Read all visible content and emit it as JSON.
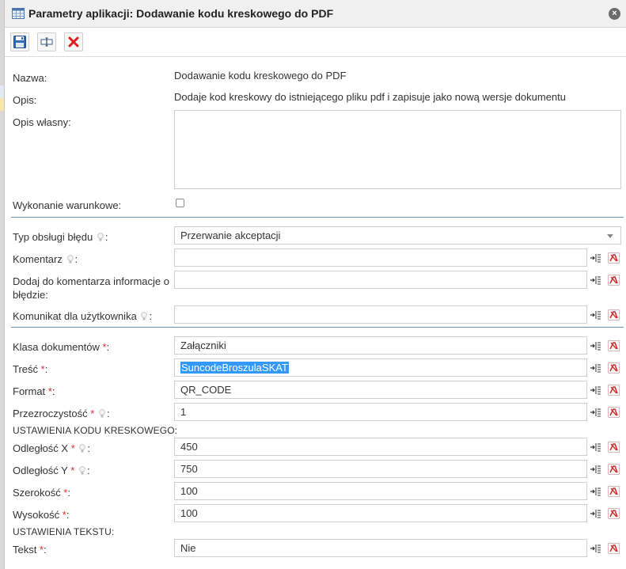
{
  "window": {
    "title": "Parametry aplikacji: Dodawanie kodu kreskowego do PDF",
    "close_symbol": "×"
  },
  "toolbar": {
    "buttons": [
      {
        "name": "save-icon"
      },
      {
        "name": "variable-editor-icon"
      },
      {
        "name": "cancel-icon"
      }
    ]
  },
  "info": {
    "name_label": "Nazwa:",
    "name_value": "Dodawanie kodu kreskowego do PDF",
    "desc_label": "Opis:",
    "desc_value": "Dodaje kod kreskowy do istniejącego pliku pdf i zapisuje jako nową wersje dokumentu",
    "own_desc_label": "Opis własny:",
    "own_desc_value": "",
    "conditional_label": "Wykonanie warunkowe:",
    "conditional_checked": false
  },
  "error_section": {
    "error_type_label": "Typ obsługi błędu",
    "error_type_value": "Przerwanie akceptacji",
    "comment_label": "Komentarz",
    "comment_value": "",
    "add_error_info_label": "Dodaj do komentarza informacje o błędzie:",
    "add_error_info_value": "",
    "user_message_label": "Komunikat dla użytkownika",
    "user_message_value": ""
  },
  "params": {
    "doc_class_label": "Klasa dokumentów",
    "doc_class_value": "Załączniki",
    "content_label": "Treść",
    "content_value": "SuncodeBroszulaSKAT",
    "format_label": "Format",
    "format_value": "QR_CODE",
    "transparency_label": "Przezroczystość",
    "transparency_value": "1",
    "barcode_section": "USTAWIENIA KODU KRESKOWEGO:",
    "dist_x_label": "Odległość X",
    "dist_x_value": "450",
    "dist_y_label": "Odległość Y",
    "dist_y_value": "750",
    "width_label": "Szerokość",
    "width_value": "100",
    "height_label": "Wysokość",
    "height_value": "100",
    "text_section": "USTAWIENIA TEKSTU:",
    "text_label": "Tekst",
    "text_value": "Nie"
  },
  "common": {
    "required_mark": "*",
    "colon": ":"
  },
  "colors": {
    "divider": "#6f8ea8",
    "required": "#d32f2f",
    "selection": "#3399ff"
  }
}
